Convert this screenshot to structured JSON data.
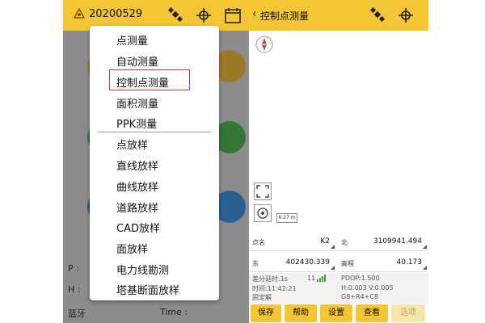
{
  "left_screen": {
    "header": {
      "project_name": "20200529"
    },
    "background_labels": {
      "p": "P :",
      "h": "H :",
      "bluetooth": "蓝牙",
      "time": "Time :"
    },
    "menu": {
      "items": [
        {
          "label": "点测量"
        },
        {
          "label": "自动测量"
        },
        {
          "label": "控制点测量",
          "highlighted": true
        },
        {
          "label": "面积测量"
        },
        {
          "label": "PPK测量"
        },
        {
          "label": "点放样"
        },
        {
          "label": "直线放样"
        },
        {
          "label": "曲线放样"
        },
        {
          "label": "道路放样"
        },
        {
          "label": "CAD放样"
        },
        {
          "label": "面放样"
        },
        {
          "label": "电力线勘测"
        },
        {
          "label": "塔基断面放样"
        }
      ],
      "highlight_color": "#e03030"
    },
    "circle_colors": [
      "#e8b33a",
      "#4caf50",
      "#3b8fd8"
    ]
  },
  "right_screen": {
    "header": {
      "back": "‹",
      "title": "控制点测量"
    },
    "map": {
      "scale_label": "6.27 m"
    },
    "fields": {
      "point_name": {
        "label": "点名",
        "value": "K2"
      },
      "north": {
        "label": "北",
        "value": "3109941.494"
      },
      "east": {
        "label": "东",
        "value": "402430.339"
      },
      "elevation": {
        "label": "高程",
        "value": "40.173"
      }
    },
    "status": {
      "solution_age": "差分延时:1s",
      "satellites": "11",
      "time": "时间:11:42:21",
      "fix": "固定解",
      "pdop": "PDOP:1.500",
      "hv": "H:0.003  V:0.005",
      "constellations": "G8+R4+C8"
    },
    "buttons": {
      "save": "保存",
      "help": "帮助",
      "settings": "设置",
      "view": "查看",
      "options": "选项"
    },
    "accent_color": "#f4c534"
  }
}
